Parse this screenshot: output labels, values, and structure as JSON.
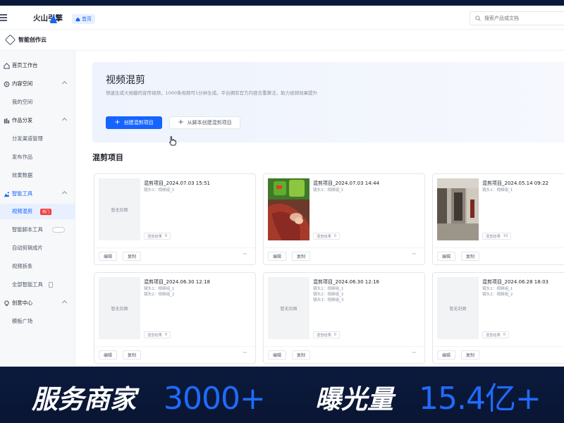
{
  "app": {
    "brand": "火山引擎",
    "home_chip": "首页",
    "search_placeholder": "搜索产品或文档",
    "workspace": "智能创作云"
  },
  "sidebar": {
    "items": [
      {
        "label": "首页工作台",
        "icon": "home-icon"
      },
      {
        "label": "内容空间",
        "icon": "folder-icon"
      },
      {
        "label": "我的空间"
      },
      {
        "label": "作品分发",
        "icon": "distribute-icon"
      },
      {
        "label": "分发渠道管理"
      },
      {
        "label": "发布作品"
      },
      {
        "label": "效果数据"
      },
      {
        "label": "智能工具",
        "icon": "tools-icon"
      },
      {
        "label": "视频混剪",
        "badge": "热门"
      },
      {
        "label": "智能脚本工具"
      },
      {
        "label": "自动剪辑成片"
      },
      {
        "label": "视频拆条"
      },
      {
        "label": "全部智能工具"
      },
      {
        "label": "创意中心",
        "icon": "creative-icon"
      },
      {
        "label": "模板广场"
      }
    ]
  },
  "hero": {
    "title": "视频混剪",
    "description": "快速生成大规模的宣传视频，1000条视频可1分钟生成。平台拥有官方内容去重算法，助力视频效果提升",
    "primary_button": "创建混剪项目",
    "secondary_button": "从脚本创建混剪项目"
  },
  "section_title": "混剪项目",
  "cards": [
    {
      "title": "混剪项目_2024.07.03 15:51",
      "lines": [
        "镜头1：视频组_1"
      ],
      "count_label": "混剪结果",
      "count": "0",
      "thumb": "暂无封面",
      "edit": "编辑",
      "copy": "复制"
    },
    {
      "title": "混剪项目_2024.07.03 14:44",
      "lines": [
        "镜头1：视频组_1"
      ],
      "count_label": "混剪结果",
      "count": "0",
      "thumb": "",
      "edit": "编辑",
      "copy": "复制"
    },
    {
      "title": "混剪项目_2024.05.14 09:22",
      "lines": [
        "镜头1：视频组_1"
      ],
      "count_label": "混剪结果",
      "count": "10",
      "thumb": "",
      "edit": "编辑",
      "copy": "复制"
    },
    {
      "title": "混剪项目_2024.06.30 12:18",
      "lines": [
        "镜头1：视频组_1",
        "镜头2：视频组_2"
      ],
      "count_label": "混剪结果",
      "count": "0",
      "thumb": "暂无封面",
      "edit": "编辑",
      "copy": "复制"
    },
    {
      "title": "混剪项目_2024.06.30 12:16",
      "lines": [
        "镜头1：视频组_1",
        "镜头2：视频组_2",
        "镜头3：视频组_3"
      ],
      "count_label": "混剪结果",
      "count": "0",
      "thumb": "暂无封面",
      "edit": "编辑",
      "copy": "复制"
    },
    {
      "title": "混剪项目_2024.06.28 18:03",
      "lines": [
        "镜头1：视频组_1",
        "镜头2：视频组_2"
      ],
      "count_label": "混剪结果",
      "count": "0",
      "thumb": "暂无封面",
      "edit": "编辑",
      "copy": "复制"
    }
  ],
  "more_label": "···",
  "banner": {
    "label1": "服务商家",
    "value1": "3000+",
    "label2": "曝光量",
    "value2": "15.4亿+"
  },
  "colors": {
    "accent": "#1664ff",
    "banner_bg": "#0b1a3d",
    "banner_value": "#1f6bff",
    "hot_badge": "#f53f3f"
  }
}
